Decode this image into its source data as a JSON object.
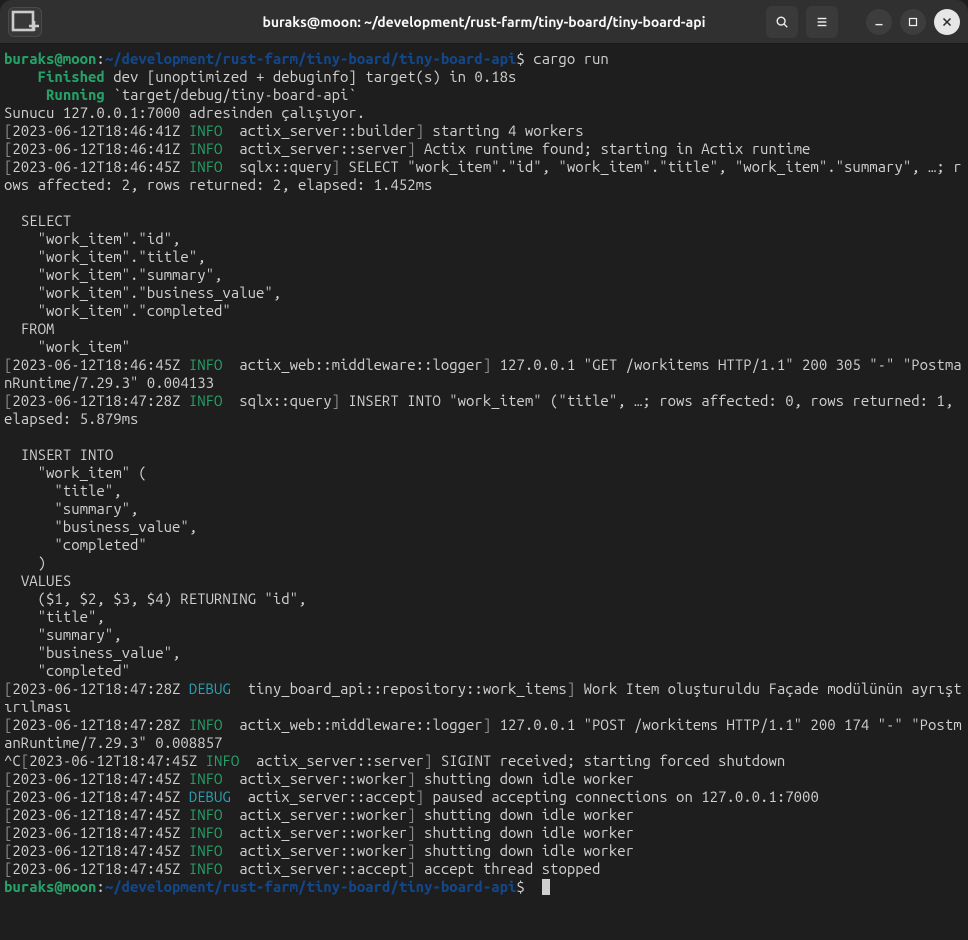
{
  "titlebar": {
    "title": "buraks@moon: ~/development/rust-farm/tiny-board/tiny-board-api"
  },
  "prompt": {
    "user_host": "buraks@moon",
    "sep": ":",
    "path": "~/development/rust-farm/tiny-board/tiny-board-api",
    "sym": "$",
    "cmd": "cargo run"
  },
  "build": {
    "finished_label": "Finished",
    "finished_rest": " dev [unoptimized + debuginfo] target(s) in 0.18s",
    "running_label": "Running",
    "running_rest": " `target/debug/tiny-board-api`"
  },
  "startup": "Sunucu 127.0.0.1:7000 adresinden çalışıyor.",
  "log1": {
    "ts": "2023-06-12T18:46:41Z",
    "lvl": "INFO",
    "mod": "actix_server::builder",
    "msg": " starting 4 workers"
  },
  "log2": {
    "ts": "2023-06-12T18:46:41Z",
    "lvl": "INFO",
    "mod": "actix_server::server",
    "msg": " Actix runtime found; starting in Actix runtime"
  },
  "log3": {
    "ts": "2023-06-12T18:46:45Z",
    "lvl": "INFO",
    "mod": "sqlx::query",
    "msg": " SELECT \"work_item\".\"id\", \"work_item\".\"title\", \"work_item\".\"summary\", …; rows affected: 2, rows returned: 2, elapsed: 1.452ms"
  },
  "sql1": "\n  SELECT\n    \"work_item\".\"id\",\n    \"work_item\".\"title\",\n    \"work_item\".\"summary\",\n    \"work_item\".\"business_value\",\n    \"work_item\".\"completed\"\n  FROM\n    \"work_item\"\n",
  "log4": {
    "ts": "2023-06-12T18:46:45Z",
    "lvl": "INFO",
    "mod": "actix_web::middleware::logger",
    "msg": " 127.0.0.1 \"GET /workitems HTTP/1.1\" 200 305 \"-\" \"PostmanRuntime/7.29.3\" 0.004133"
  },
  "log5": {
    "ts": "2023-06-12T18:47:28Z",
    "lvl": "INFO",
    "mod": "sqlx::query",
    "msg": " INSERT INTO \"work_item\" (\"title\", …; rows affected: 0, rows returned: 1, elapsed: 5.879ms"
  },
  "sql2": "\n  INSERT INTO\n    \"work_item\" (\n      \"title\",\n      \"summary\",\n      \"business_value\",\n      \"completed\"\n    )\n  VALUES\n    ($1, $2, $3, $4) RETURNING \"id\",\n    \"title\",\n    \"summary\",\n    \"business_value\",\n    \"completed\"\n",
  "log6": {
    "ts": "2023-06-12T18:47:28Z",
    "lvl": "DEBUG",
    "mod": "tiny_board_api::repository::work_items",
    "msg": " Work Item oluşturuldu Façade modülünün ayrıştırılması"
  },
  "log7": {
    "ts": "2023-06-12T18:47:28Z",
    "lvl": "INFO",
    "mod": "actix_web::middleware::logger",
    "msg": " 127.0.0.1 \"POST /workitems HTTP/1.1\" 200 174 \"-\" \"PostmanRuntime/7.29.3\" 0.008857"
  },
  "ctrlc": "^C",
  "log8": {
    "ts": "2023-06-12T18:47:45Z",
    "lvl": "INFO",
    "mod": "actix_server::server",
    "msg": " SIGINT received; starting forced shutdown"
  },
  "log9": {
    "ts": "2023-06-12T18:47:45Z",
    "lvl": "INFO",
    "mod": "actix_server::worker",
    "msg": " shutting down idle worker"
  },
  "log10": {
    "ts": "2023-06-12T18:47:45Z",
    "lvl": "DEBUG",
    "mod": "actix_server::accept",
    "msg": " paused accepting connections on 127.0.0.1:7000"
  },
  "log11": {
    "ts": "2023-06-12T18:47:45Z",
    "lvl": "INFO",
    "mod": "actix_server::worker",
    "msg": " shutting down idle worker"
  },
  "log12": {
    "ts": "2023-06-12T18:47:45Z",
    "lvl": "INFO",
    "mod": "actix_server::worker",
    "msg": " shutting down idle worker"
  },
  "log13": {
    "ts": "2023-06-12T18:47:45Z",
    "lvl": "INFO",
    "mod": "actix_server::worker",
    "msg": " shutting down idle worker"
  },
  "log14": {
    "ts": "2023-06-12T18:47:45Z",
    "lvl": "INFO",
    "mod": "actix_server::accept",
    "msg": " accept thread stopped"
  },
  "prompt2": {
    "user_host": "buraks@moon",
    "sep": ":",
    "path": "~/development/rust-farm/tiny-board/tiny-board-api",
    "sym": "$",
    "cmd": " "
  }
}
